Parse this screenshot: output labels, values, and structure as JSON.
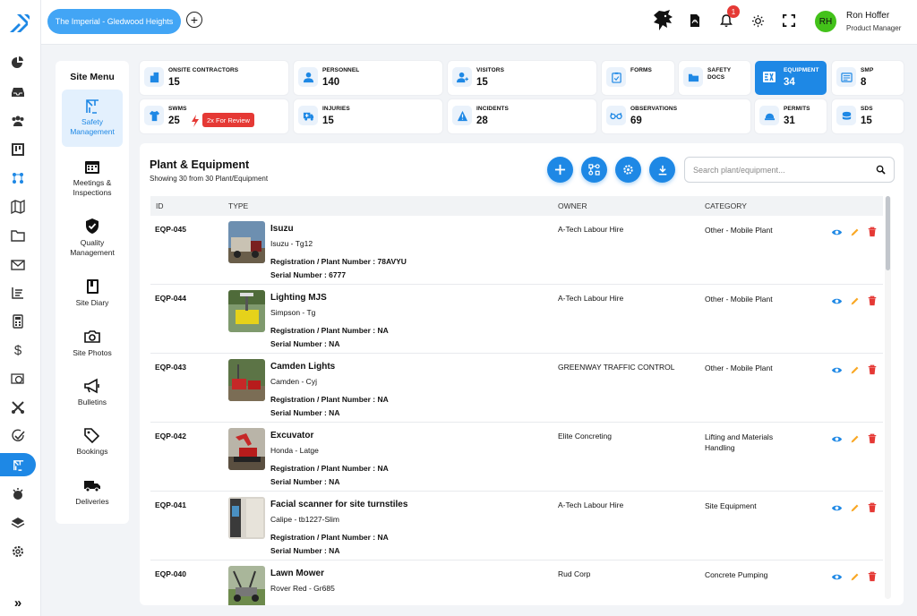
{
  "topbar": {
    "site": "The Imperial - Gledwood Heights",
    "notifications_count": "1",
    "user": {
      "initials": "RH",
      "name": "Ron Hoffer",
      "role": "Product Manager"
    }
  },
  "site_menu": {
    "title": "Site Menu",
    "items": [
      {
        "label": "Safety Management",
        "icon": "crane-icon",
        "active": true
      },
      {
        "label": "Meetings & Inspections",
        "icon": "calendar-icon"
      },
      {
        "label": "Quality Management",
        "icon": "shield-check-icon"
      },
      {
        "label": "Site Diary",
        "icon": "diary-icon"
      },
      {
        "label": "Site Photos",
        "icon": "camera-icon"
      },
      {
        "label": "Bulletins",
        "icon": "megaphone-icon"
      },
      {
        "label": "Bookings",
        "icon": "tags-icon"
      },
      {
        "label": "Deliveries",
        "icon": "truck-icon"
      }
    ]
  },
  "stats": [
    {
      "label": "ONSITE CONTRACTORS",
      "value": "15",
      "icon": "building-icon"
    },
    {
      "label": "PERSONNEL",
      "value": "140",
      "icon": "person-icon"
    },
    {
      "label": "VISITORS",
      "value": "15",
      "icon": "visitor-icon"
    },
    {
      "label": "FORMS",
      "value": "",
      "icon": "clipboard-icon"
    },
    {
      "label": "SAFETY DOCS",
      "value": "",
      "icon": "folder-icon"
    },
    {
      "label": "EQUIPMENT",
      "value": "34",
      "icon": "equipment-icon",
      "selected": true
    },
    {
      "label": "SMP",
      "value": "8",
      "icon": "id-card-icon"
    },
    {
      "label": "SWMS",
      "value": "25",
      "icon": "shirt-icon"
    },
    {
      "label": "INJURIES",
      "value": "15",
      "icon": "ambulance-icon"
    },
    {
      "label": "INCIDENTS",
      "value": "28",
      "icon": "warning-icon"
    },
    {
      "label": "OBSERVATIONS",
      "value": "69",
      "icon": "glasses-icon"
    },
    {
      "label": "PERMITS",
      "value": "31",
      "icon": "hardhat-icon"
    },
    {
      "label": "SDS",
      "value": "15",
      "icon": "barrel-icon"
    }
  ],
  "swms_review": "2x For Review",
  "panel": {
    "title": "Plant & Equipment",
    "subtitle": "Showing 30 from 30 Plant/Equipment",
    "search_placeholder": "Search plant/equipment...",
    "columns": {
      "id": "ID",
      "type": "TYPE",
      "owner": "OWNER",
      "category": "CATEGORY"
    }
  },
  "rows": [
    {
      "id": "EQP-045",
      "title": "Isuzu",
      "model": "Isuzu - Tg12",
      "reg": "Registration / Plant Number : 78AVYU",
      "serial": "Serial Number : 6777",
      "owner": "A-Tech Labour Hire",
      "category": "Other - Mobile Plant"
    },
    {
      "id": "EQP-044",
      "title": "Lighting MJS",
      "model": "Simpson - Tg",
      "reg": "Registration / Plant Number : NA",
      "serial": "Serial Number : NA",
      "owner": "A-Tech Labour Hire",
      "category": "Other - Mobile Plant"
    },
    {
      "id": "EQP-043",
      "title": "Camden Lights",
      "model": "Camden - Cyj",
      "reg": "Registration / Plant Number : NA",
      "serial": "Serial Number : NA",
      "owner": "GREENWAY TRAFFIC CONTROL",
      "category": "Other - Mobile Plant"
    },
    {
      "id": "EQP-042",
      "title": "Excuvator",
      "model": "Honda - Latge",
      "reg": "Registration / Plant Number : NA",
      "serial": "Serial Number : NA",
      "owner": "Elite Concreting",
      "category": "Lifting and Materials Handling"
    },
    {
      "id": "EQP-041",
      "title": "Facial scanner for site turnstiles",
      "model": "Calipe - tb1227-Slim",
      "reg": "Registration / Plant Number : NA",
      "serial": "Serial Number : NA",
      "owner": "A-Tech Labour Hire",
      "category": "Site Equipment"
    },
    {
      "id": "EQP-040",
      "title": "Lawn Mower",
      "model": "Rover Red - Gr685",
      "reg": "",
      "serial": "",
      "owner": "Rud Corp",
      "category": "Concrete Pumping"
    }
  ],
  "colors": {
    "accent": "#1e88e5",
    "danger": "#e53935",
    "edit": "#f9a825"
  }
}
